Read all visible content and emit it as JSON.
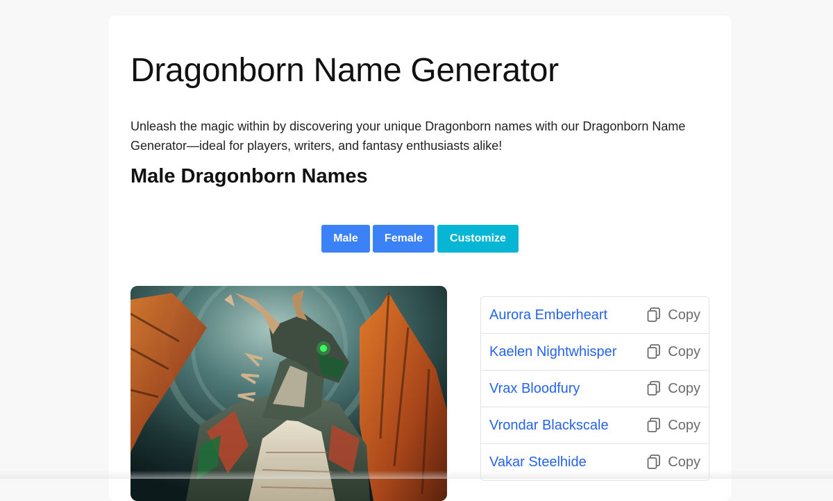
{
  "page": {
    "title": "Dragonborn Name Generator",
    "description": "Unleash the magic within by discovering your unique Dragonborn names with our Dragonborn Name Generator—ideal for players, writers, and fantasy enthusiasts alike!",
    "subtitle": "Male Dragonborn Names"
  },
  "buttons": {
    "male": "Male",
    "female": "Female",
    "customize": "Customize"
  },
  "names": [
    {
      "name": "Aurora Emberheart",
      "copy_label": "Copy"
    },
    {
      "name": "Kaelen Nightwhisper",
      "copy_label": "Copy"
    },
    {
      "name": "Vrax Bloodfury",
      "copy_label": "Copy"
    },
    {
      "name": "Vrondar Blackscale",
      "copy_label": "Copy"
    },
    {
      "name": "Vakar Steelhide",
      "copy_label": "Copy"
    }
  ],
  "colors": {
    "primary_button": "#3b82f6",
    "customize_button": "#06b6d4",
    "name_link": "#2563eb"
  },
  "icons": {
    "copy": "copy-icon"
  }
}
